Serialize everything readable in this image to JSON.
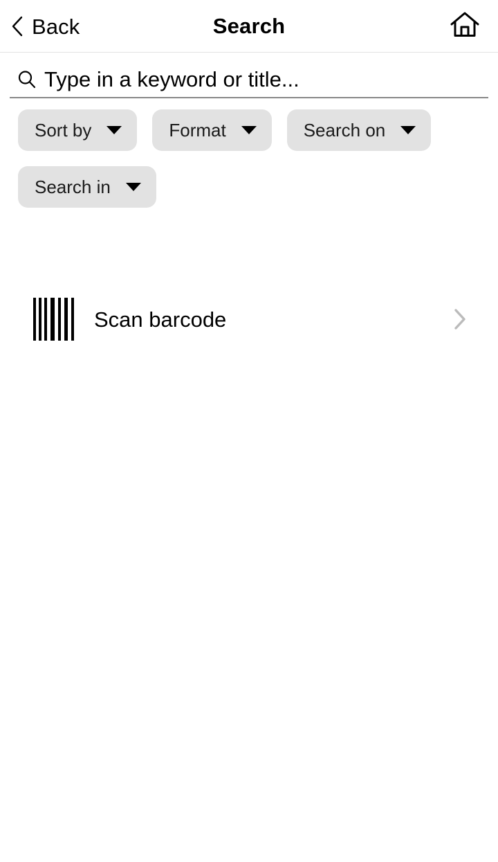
{
  "header": {
    "back_label": "Back",
    "title": "Search",
    "back_icon": "chevron-left-icon",
    "home_icon": "home-icon"
  },
  "search": {
    "icon": "search-icon",
    "value": "",
    "placeholder": "Type in a keyword or title..."
  },
  "filters": {
    "chips": [
      {
        "label": "Sort by",
        "icon": "chevron-down-icon"
      },
      {
        "label": "Format",
        "icon": "chevron-down-icon"
      },
      {
        "label": "Search on",
        "icon": "chevron-down-icon"
      },
      {
        "label": "Search in",
        "icon": "chevron-down-icon"
      }
    ]
  },
  "actions": {
    "scan": {
      "label": "Scan barcode",
      "icon": "barcode-icon",
      "disclosure_icon": "chevron-right-icon"
    }
  },
  "colors": {
    "background": "#ffffff",
    "text": "#000000",
    "chip_background": "#e2e2e2",
    "divider": "#e3e3e3",
    "search_underline": "#888888",
    "disclosure": "#bbbbbb"
  }
}
